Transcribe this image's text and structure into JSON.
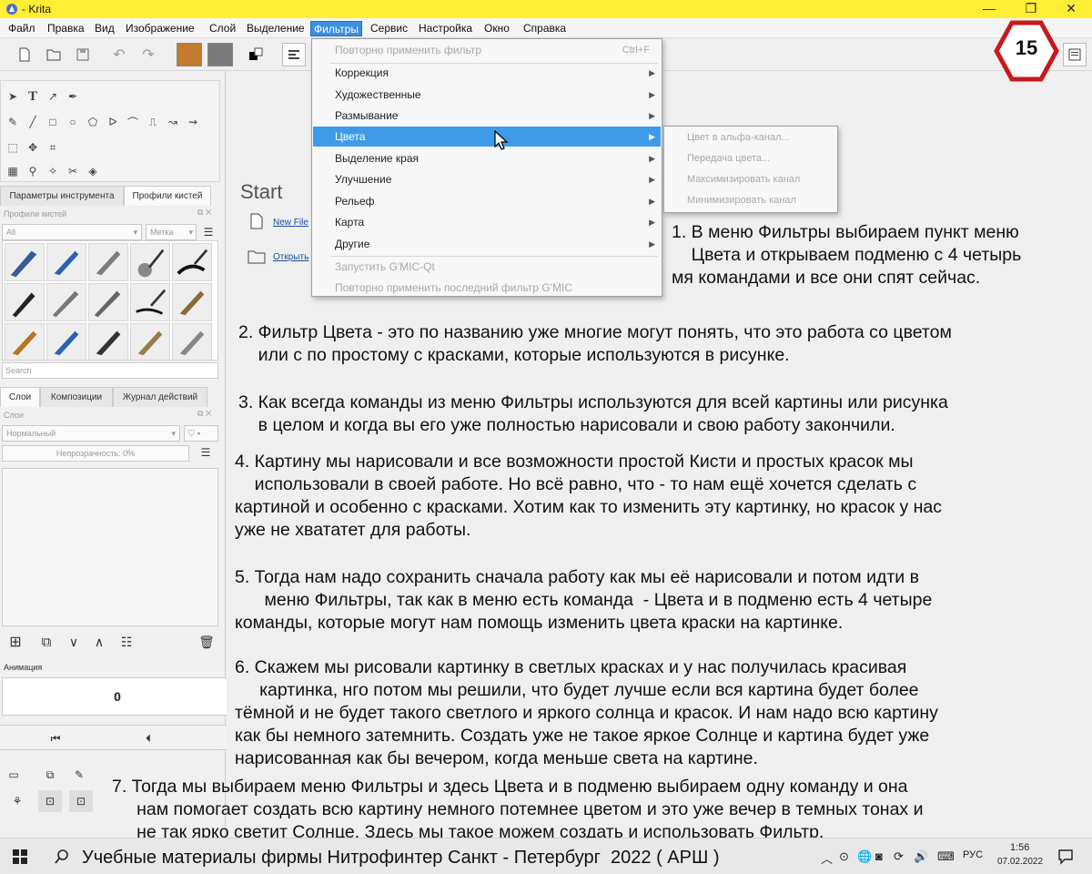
{
  "window": {
    "title": "- Krita",
    "minimize": "—",
    "maximize": "❐",
    "close": "✕"
  },
  "menubar": {
    "items": [
      "Файл",
      "Правка",
      "Вид",
      "Изображение",
      "Слой",
      "Выделение",
      "Фильтры",
      "Сервис",
      "Настройка",
      "Окно",
      "Справка"
    ],
    "active": "Фильтры"
  },
  "filters_menu": {
    "reapply": "Повторно применить фильтр",
    "reapply_shortcut": "Ctrl+F",
    "items": [
      "Коррекция",
      "Художественные",
      "Размывание",
      "Цвета",
      "Выделение края",
      "Улучшение",
      "Рельеф",
      "Карта",
      "Другие"
    ],
    "highlighted": "Цвета",
    "gmic_start": "Запустить G'MIC-Qt",
    "gmic_reapply": "Повторно применить последний фильтр G'MIC"
  },
  "colors_submenu": {
    "items": [
      "Цвет в альфа-канал...",
      "Передача цвета...",
      "Максимизировать канал",
      "Минимизировать канал"
    ]
  },
  "left_panel": {
    "tab_tool_options": "Параметры инструмента",
    "tab_brush_presets": "Профили кистей",
    "brush_presets_title": "Профили кистей",
    "filter_all": "All",
    "tag_label": "Метка",
    "search_placeholder": "Search",
    "tab_layers": "Слои",
    "tab_compositions": "Композиции",
    "tab_history": "Журнал действий",
    "layers_title": "Слои",
    "blend_mode": "Нормальный",
    "opacity": "Непрозрачность:  0%",
    "animation_title": "Анимация",
    "frame_number": "0"
  },
  "welcome": {
    "start": "Start",
    "new_file": "New File",
    "open_file": "Открыть"
  },
  "badge": {
    "number": "15",
    "color": "#c8191e"
  },
  "notes": [
    "1. В меню Фильтры выбираем пункт меню",
    "    Цвета и открываем подменю с 4 четырь",
    "мя командами и все они спят сейчас.",
    "2. Фильтр Цвета - это по названию уже многие могут понять, что это работа со цветом",
    "    или с по простому с красками, которые используются в рисунке.",
    "3. Как всегда команды из меню Фильтры используются для всей картины или рисунка",
    "    в целом и когда вы его уже полностью нарисовали и свою работу закончили.",
    "4. Картину мы нарисовали и все возможности простой Кисти и простых красок мы",
    "    использовали в своей работе. Но всё равно, что - то нам ещё хочется сделать с",
    "картиной и особенно с красками. Хотим как то изменить эту картинку, но красок у нас",
    "уже не хвататет для работы.",
    "5. Тогда нам надо сохранить сначала работу как мы её нарисовали и потом идти в",
    "      меню Фильтры, так как в меню есть команда  - Цвета и в подменю есть 4 четыре",
    "команды, которые могут нам помощь изменить цвета краски на картинке.",
    "6. Скажем мы рисовали картинку в светлых красках и у нас получилась красивая",
    "     картинка, нго потом мы решили, что будет лучше если вся картина будет более",
    "тёмной и не будет такого светлого и яркого солнца и красок. И нам надо всю картину",
    "как бы немного затемнить. Создать уже не такое яркое Солнце и картина будет уже",
    "нарисованная как бы вечером, когда меньше света на картине.",
    "7. Тогда мы выбираем меню Фильтры и здесь Цвета и в подменю выбираем одну команду и она",
    "     нам помогает создать всю картину немного потемнее цветом и это уже вечер в темных тонах и",
    "     не так ярко светит Солнце. Здесь мы такое можем создать и использовать Фильтр."
  ],
  "taskbar": {
    "caption": "Учебные материалы фирмы Нитрофинтер Санкт - Петербург  2022 ( АРШ )",
    "language": "РУС",
    "time": "1:56",
    "date": "07.02.2022"
  },
  "colors": {
    "titlebar": "#ffee33",
    "highlight": "#3d9be9",
    "fg_swatch": "#c27a2e",
    "bg_swatch": "#7a7a7a"
  }
}
